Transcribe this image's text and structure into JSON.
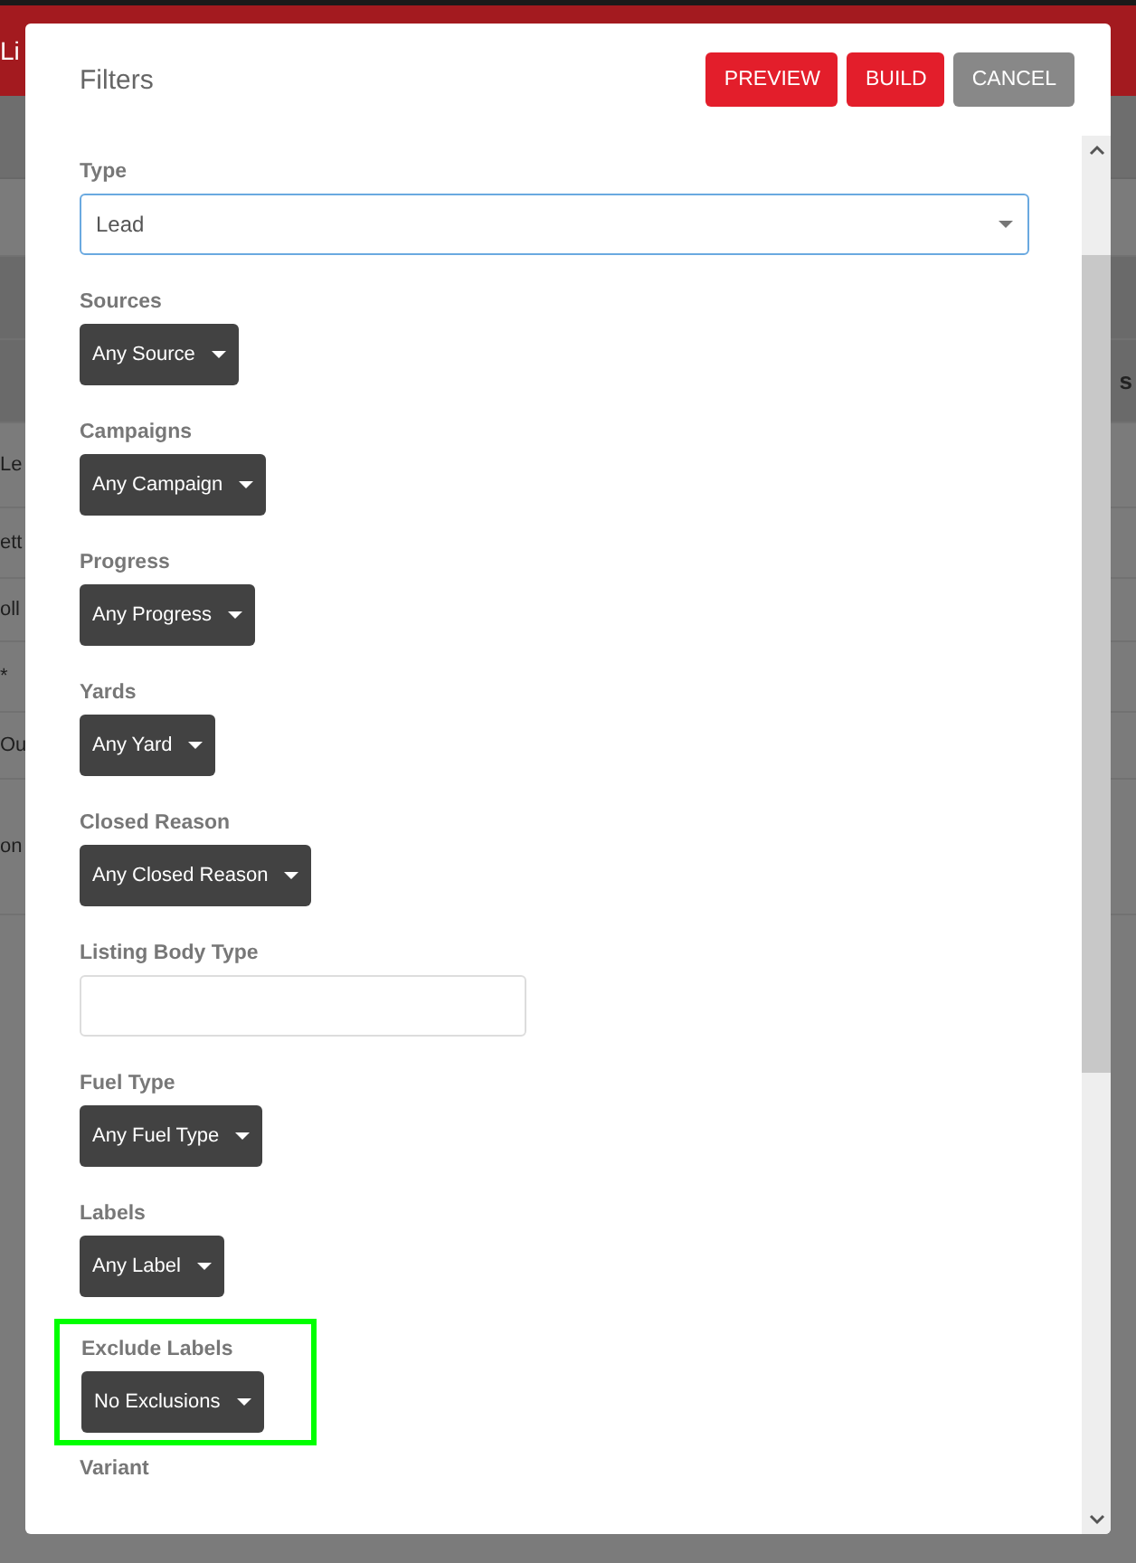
{
  "background": {
    "header_text": "Li",
    "rows": [
      {
        "left": "Le"
      },
      {
        "left": "ett"
      },
      {
        "left": "oll"
      },
      {
        "left": "*"
      },
      {
        "left": "Ou"
      },
      {
        "left": "on"
      }
    ],
    "right_text": "s"
  },
  "dialog": {
    "title": "Filters",
    "buttons": [
      {
        "label": "PREVIEW",
        "kind": "primary"
      },
      {
        "label": "BUILD",
        "kind": "primary"
      },
      {
        "label": "CANCEL",
        "kind": "secondary"
      }
    ],
    "fields": [
      {
        "label": "Type",
        "kind": "select",
        "value": "Lead",
        "highlighted": false
      },
      {
        "label": "Sources",
        "kind": "dropdown",
        "value": "Any Source",
        "highlighted": false
      },
      {
        "label": "Campaigns",
        "kind": "dropdown",
        "value": "Any Campaign",
        "highlighted": false
      },
      {
        "label": "Progress",
        "kind": "dropdown",
        "value": "Any Progress",
        "highlighted": false
      },
      {
        "label": "Yards",
        "kind": "dropdown",
        "value": "Any Yard",
        "highlighted": false
      },
      {
        "label": "Closed Reason",
        "kind": "dropdown",
        "value": "Any Closed Reason",
        "highlighted": false
      },
      {
        "label": "Listing Body Type",
        "kind": "text",
        "highlighted": false
      },
      {
        "label": "Fuel Type",
        "kind": "dropdown",
        "value": "Any Fuel Type",
        "highlighted": false
      },
      {
        "label": "Labels",
        "kind": "dropdown",
        "value": "Any Label",
        "highlighted": false
      },
      {
        "label": "Exclude Labels",
        "kind": "dropdown",
        "value": "No Exclusions",
        "highlighted": true
      },
      {
        "label": "Variant",
        "kind": "heading",
        "highlighted": false
      }
    ]
  }
}
